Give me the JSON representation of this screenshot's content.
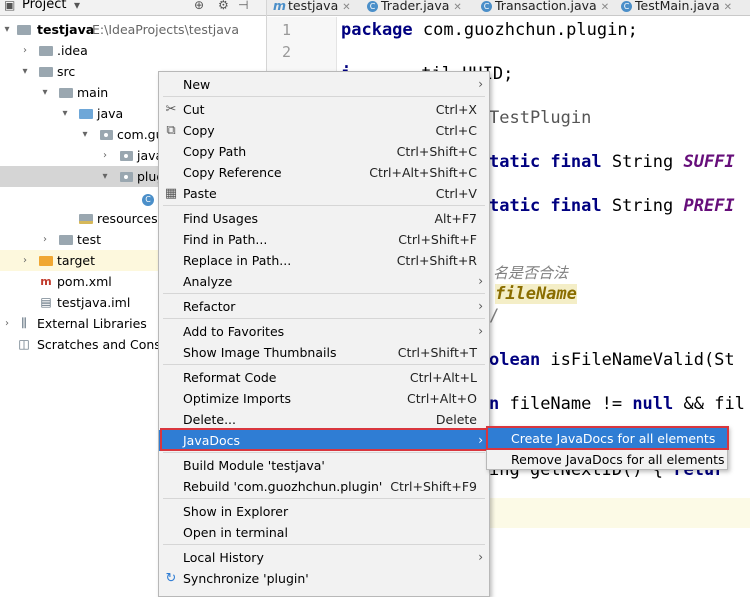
{
  "project": {
    "title": "Project",
    "tree": [
      {
        "label": "testjava",
        "path": "E:\\IdeaProjects\\testjava",
        "icon": "folder-icon"
      },
      {
        "label": ".idea",
        "icon": "folder-icon"
      },
      {
        "label": "src",
        "icon": "folder-icon"
      },
      {
        "label": "main",
        "icon": "folder-icon"
      },
      {
        "label": "java",
        "icon": "source-folder-icon"
      },
      {
        "label": "com.gu",
        "icon": "package-icon"
      },
      {
        "label": "java",
        "icon": "package-icon"
      },
      {
        "label": "plug",
        "icon": "package-icon"
      },
      {
        "label": "",
        "icon": "class-icon"
      },
      {
        "label": "resources",
        "icon": "resources-folder-icon"
      },
      {
        "label": "test",
        "icon": "folder-icon"
      },
      {
        "label": "target",
        "icon": "excluded-folder-icon"
      },
      {
        "label": "pom.xml",
        "icon": "maven-icon"
      },
      {
        "label": "testjava.iml",
        "icon": "module-file-icon"
      },
      {
        "label": "External Libraries",
        "icon": "libraries-icon"
      },
      {
        "label": "Scratches and Conso",
        "icon": "scratches-icon"
      }
    ]
  },
  "editor": {
    "tabs": [
      {
        "label": "testjava",
        "icon": "module-m-icon"
      },
      {
        "label": "Trader.java",
        "icon": "class-icon"
      },
      {
        "label": "Transaction.java",
        "icon": "class-icon"
      },
      {
        "label": "TestMain.java",
        "icon": "class-icon"
      }
    ],
    "line_numbers": [
      "1",
      "2"
    ],
    "code": {
      "line1_kw": "package",
      "line1_rest": " com.guozhchun.plugin;",
      "line2_kw": "i",
      "line2_rest": "til.UUID;",
      "line3": "TestPlugin",
      "line4_kw": "tatic final",
      "line4_type": " String ",
      "line4_const": "SUFFI",
      "line5_kw": "tatic final",
      "line5_type": " String ",
      "line5_const": "PREFI",
      "line6_comment": "名是否合法",
      "line7_param": "fileName",
      "line8": "/",
      "line9_kw": "olean",
      "line9_rest": " isFileNameValid(St",
      "line10_kw1": "n",
      "line10_mid": " fileName != ",
      "line10_kw2": "null",
      "line10_rest": " && fil",
      "line11_rest": "ing getNextID() { ",
      "line11_kw": "retur"
    }
  },
  "context_menu": {
    "items": [
      {
        "label": "New",
        "shortcut": "",
        "submenu": true,
        "icon": ""
      },
      {
        "label": "Cut",
        "shortcut": "Ctrl+X",
        "icon": "cut-icon"
      },
      {
        "label": "Copy",
        "shortcut": "Ctrl+C",
        "icon": "copy-icon"
      },
      {
        "label": "Copy Path",
        "shortcut": "Ctrl+Shift+C",
        "icon": ""
      },
      {
        "label": "Copy Reference",
        "shortcut": "Ctrl+Alt+Shift+C",
        "icon": ""
      },
      {
        "label": "Paste",
        "shortcut": "Ctrl+V",
        "icon": "paste-icon"
      },
      {
        "label": "Find Usages",
        "shortcut": "Alt+F7",
        "icon": ""
      },
      {
        "label": "Find in Path...",
        "shortcut": "Ctrl+Shift+F",
        "icon": ""
      },
      {
        "label": "Replace in Path...",
        "shortcut": "Ctrl+Shift+R",
        "icon": ""
      },
      {
        "label": "Analyze",
        "shortcut": "",
        "submenu": true,
        "icon": ""
      },
      {
        "label": "Refactor",
        "shortcut": "",
        "submenu": true,
        "icon": ""
      },
      {
        "label": "Add to Favorites",
        "shortcut": "",
        "submenu": true,
        "icon": ""
      },
      {
        "label": "Show Image Thumbnails",
        "shortcut": "Ctrl+Shift+T",
        "icon": ""
      },
      {
        "label": "Reformat Code",
        "shortcut": "Ctrl+Alt+L",
        "icon": ""
      },
      {
        "label": "Optimize Imports",
        "shortcut": "Ctrl+Alt+O",
        "icon": ""
      },
      {
        "label": "Delete...",
        "shortcut": "Delete",
        "icon": ""
      },
      {
        "label": "JavaDocs",
        "shortcut": "",
        "submenu": true,
        "icon": ""
      },
      {
        "label": "Build Module 'testjava'",
        "shortcut": "",
        "icon": ""
      },
      {
        "label": "Rebuild 'com.guozhchun.plugin'",
        "shortcut": "Ctrl+Shift+F9",
        "icon": ""
      },
      {
        "label": "Show in Explorer",
        "shortcut": "",
        "icon": ""
      },
      {
        "label": "Open in terminal",
        "shortcut": "",
        "icon": ""
      },
      {
        "label": "Local History",
        "shortcut": "",
        "submenu": true,
        "icon": ""
      },
      {
        "label": "Synchronize 'plugin'",
        "shortcut": "",
        "icon": "sync-icon"
      }
    ],
    "selected": "JavaDocs"
  },
  "submenu": {
    "items": [
      {
        "label": "Create JavaDocs for all elements"
      },
      {
        "label": "Remove JavaDocs for all elements"
      }
    ],
    "selected": "Create JavaDocs for all elements"
  },
  "colors": {
    "selection": "#2f7dd4",
    "highlight_box": "#d9363e",
    "menu_bg": "#f2f2f2"
  }
}
